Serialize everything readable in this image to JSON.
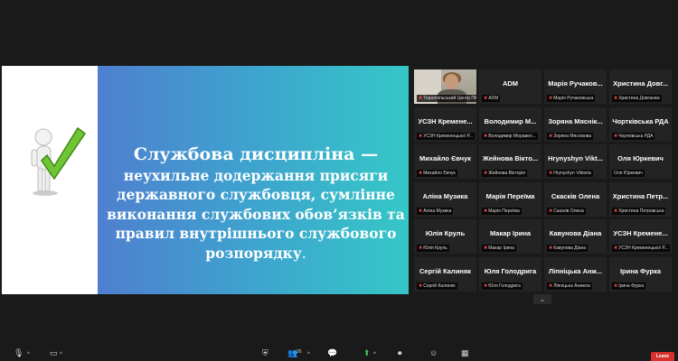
{
  "slide": {
    "title": "Службова дисципліна",
    "dash": " —",
    "line1": "неухильне додержання присяги",
    "line2": "державного службовця, сумлінне",
    "line3": "виконання службових обов’язків та",
    "line4": "правил внутрішнього службового",
    "line5": "розпорядку",
    "end": "."
  },
  "tiles": [
    {
      "name": "",
      "label": "Тернопільський Центр ПК",
      "active": true,
      "video": true
    },
    {
      "name": "ADM",
      "label": "ADM"
    },
    {
      "name": "Марія Ручаков...",
      "label": "Марія Ручаковська"
    },
    {
      "name": "Христина Довг...",
      "label": "Христина Довганюк"
    },
    {
      "name": "УСЗН Кремене...",
      "label": "УСЗН Кременецької Р..."
    },
    {
      "name": "Володимир М...",
      "label": "Володимир Моравел..."
    },
    {
      "name": "Зоряна Мяснік...",
      "label": "Зоряна Мяснікова"
    },
    {
      "name": "Чортківська РДА",
      "label": "Чортківська РДА"
    },
    {
      "name": "Михайло Євчук",
      "label": "Михайло Євчук"
    },
    {
      "name": "Жейнова Вікто...",
      "label": "Жейнова Вікторія"
    },
    {
      "name": "Hrynyshyn Vikt...",
      "label": "Hrynyshyn Viktoria"
    },
    {
      "name": "Оля Юркевич",
      "label": "Оля Юркевич",
      "mic_on": true
    },
    {
      "name": "Аліна Музика",
      "label": "Аліна Музика"
    },
    {
      "name": "Марія Переїма",
      "label": "Марія Переїма"
    },
    {
      "name": "Скаскiв Олена",
      "label": "Скаскiв Олена"
    },
    {
      "name": "Христина Петр...",
      "label": "Христина Петровська"
    },
    {
      "name": "Юлія Круль",
      "label": "Юлія Круль"
    },
    {
      "name": "Макар Ірина",
      "label": "Макар Ірина"
    },
    {
      "name": "Кавунова Діана",
      "label": "Кавунова Діана"
    },
    {
      "name": "УСЗН Кремене...",
      "label": "УСЗН Кременецької Р..."
    },
    {
      "name": "Сергій Калиняк",
      "label": "Сергій Калиняк"
    },
    {
      "name": "Юля Голодрига",
      "label": "Юля Голодрига"
    },
    {
      "name": "Ліпніцька Анж...",
      "label": "Ліпніцька Анжела"
    },
    {
      "name": "Ірина Фурка",
      "label": "Ірина Фурка"
    }
  ],
  "participants_count": "26",
  "leave_label": "Leave",
  "colors": {
    "active_border": "#e6d43a",
    "leave": "#d8302c",
    "muted": "#e84a4a"
  }
}
